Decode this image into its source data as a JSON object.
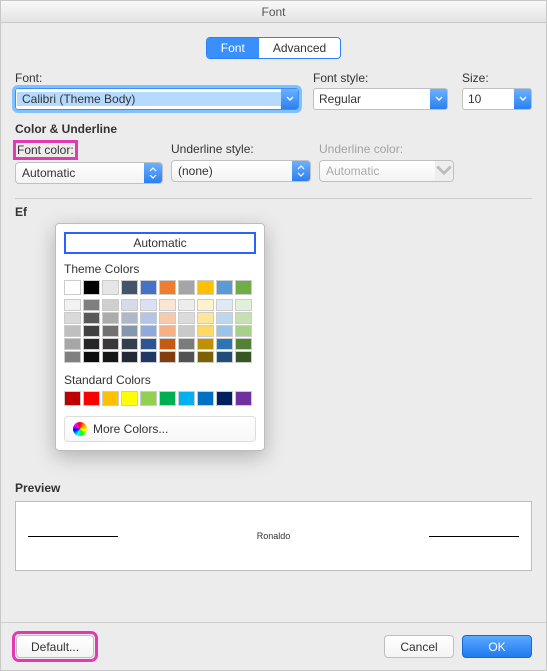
{
  "title": "Font",
  "tabs": {
    "font": "Font",
    "advanced": "Advanced"
  },
  "labels": {
    "font": "Font:",
    "fontStyle": "Font style:",
    "size": "Size:",
    "colorUnderline": "Color & Underline",
    "fontColor": "Font color:",
    "underlineStyle": "Underline style:",
    "underlineColor": "Underline color:",
    "effects": "Ef",
    "preview": "Preview"
  },
  "values": {
    "font": "Calibri (Theme Body)",
    "fontStyle": "Regular",
    "size": "10",
    "fontColor": "Automatic",
    "underlineStyle": "(none)",
    "underlineColor": "Automatic",
    "previewText": "Ronaldo"
  },
  "popover": {
    "automatic": "Automatic",
    "themeHeader": "Theme Colors",
    "themeTop": [
      "#ffffff",
      "#000000",
      "#e7e6e6",
      "#44546a",
      "#4472c4",
      "#ed7d31",
      "#a5a5a5",
      "#ffc000",
      "#5b9bd5",
      "#70ad47"
    ],
    "themeShades": [
      [
        "#f2f2f2",
        "#d9d9d9",
        "#bfbfbf",
        "#a6a6a6",
        "#808080"
      ],
      [
        "#7f7f7f",
        "#595959",
        "#404040",
        "#262626",
        "#0d0d0d"
      ],
      [
        "#d0cece",
        "#aeabab",
        "#757070",
        "#3a3838",
        "#171616"
      ],
      [
        "#d6dce5",
        "#adb9ca",
        "#8497b0",
        "#323f4f",
        "#222a35"
      ],
      [
        "#d9e2f3",
        "#b4c6e7",
        "#8eaadb",
        "#2f5496",
        "#1f3864"
      ],
      [
        "#fbe5d5",
        "#f7caac",
        "#f4b183",
        "#c55a11",
        "#833c0b"
      ],
      [
        "#ededed",
        "#dbdbdb",
        "#c9c9c9",
        "#7b7b7b",
        "#525252"
      ],
      [
        "#fff2cc",
        "#fee599",
        "#ffd965",
        "#bf9000",
        "#7f6000"
      ],
      [
        "#deebf6",
        "#bdd7ee",
        "#9cc3e5",
        "#2e75b5",
        "#1e4e79"
      ],
      [
        "#e2efd9",
        "#c5e0b3",
        "#a8d08d",
        "#538135",
        "#375623"
      ]
    ],
    "standardHeader": "Standard Colors",
    "standard": [
      "#c00000",
      "#ff0000",
      "#ffc000",
      "#ffff00",
      "#92d050",
      "#00b050",
      "#00b0f0",
      "#0070c0",
      "#002060",
      "#7030a0"
    ],
    "moreColors": "More Colors..."
  },
  "buttons": {
    "default": "Default...",
    "cancel": "Cancel",
    "ok": "OK"
  }
}
